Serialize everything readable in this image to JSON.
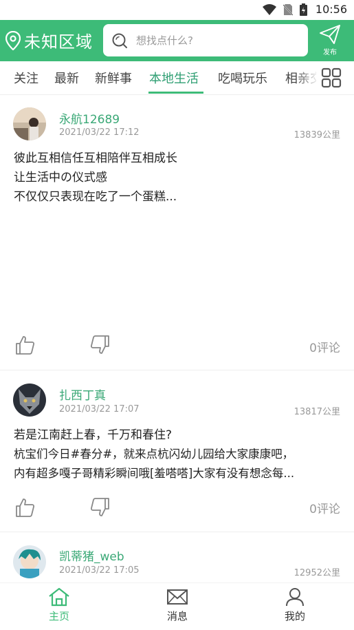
{
  "status_bar": {
    "time": "10:56",
    "icons": [
      "wifi-icon",
      "no-sim-icon",
      "battery-icon"
    ]
  },
  "header": {
    "location": "未知区域",
    "search_placeholder": "想找点什么?",
    "publish_label": "发布",
    "background_color": "#3dbb78"
  },
  "tabs": {
    "items": [
      "关注",
      "最新",
      "新鲜事",
      "本地生活",
      "吃喝玩乐",
      "相亲交友"
    ],
    "active": "本地生活",
    "accent_color": "#3dbb78"
  },
  "posts": [
    {
      "username": "永航12689",
      "time": "2021/03/22 17:12",
      "distance": "13839公里",
      "lines": [
        "彼此互相信任互相陪伴互相成长",
        "让生活中の仪式感",
        "不仅仅只表现在吃了一个蛋糕..."
      ],
      "comments": "0评论"
    },
    {
      "username": "扎西丁真",
      "time": "2021/03/22 17:07",
      "distance": "13817公里",
      "lines": [
        "若是江南赶上春，千万和春住?",
        "杭宝们今日#春分#，就来点杭闪幼儿园给大家康康吧，",
        "内有超多嘎子哥精彩瞬间哦[羞嗒嗒]大家有没有想念每..."
      ],
      "comments": "0评论"
    },
    {
      "username": "凯蒂猪_web",
      "time": "2021/03/22 17:05",
      "distance": "12952公里"
    }
  ],
  "bottom_nav": {
    "items": [
      {
        "label": "主页",
        "icon": "home-icon"
      },
      {
        "label": "消息",
        "icon": "mail-icon"
      },
      {
        "label": "我的",
        "icon": "user-icon"
      }
    ],
    "active": "主页"
  }
}
